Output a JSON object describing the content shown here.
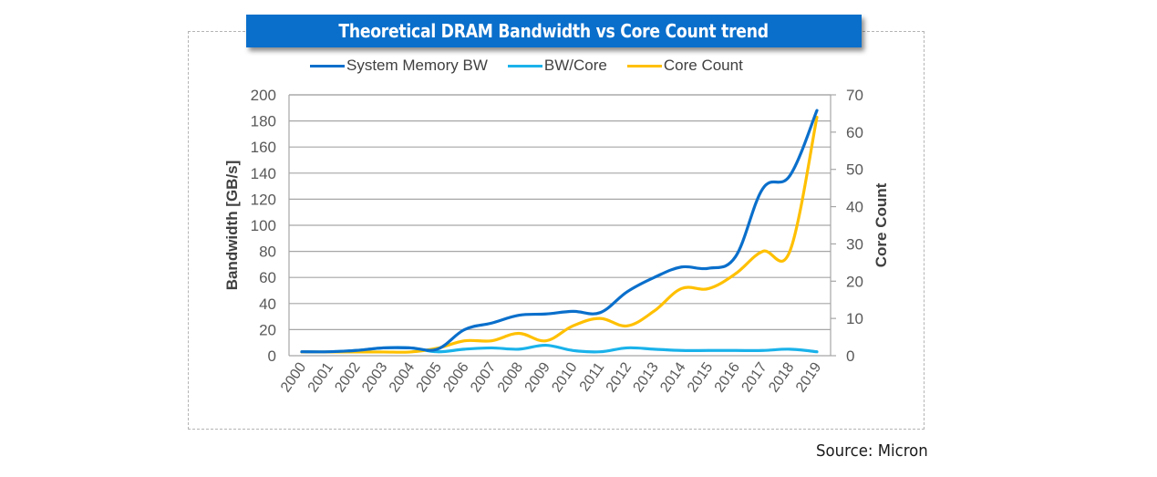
{
  "title": "Theoretical DRAM Bandwidth vs Core Count trend",
  "source": "Source: Micron",
  "chart_data": {
    "type": "line",
    "title": "Theoretical DRAM Bandwidth vs Core Count trend",
    "x": [
      "2000",
      "2001",
      "2002",
      "2003",
      "2004",
      "2005",
      "2006",
      "2007",
      "2008",
      "2009",
      "2010",
      "2011",
      "2012",
      "2013",
      "2014",
      "2015",
      "2016",
      "2017",
      "2018",
      "2019"
    ],
    "xlabel": "",
    "ylabel": "Bandwidth [GB/s]",
    "ylim": [
      0,
      200
    ],
    "yticks": [
      0,
      20,
      40,
      60,
      80,
      100,
      120,
      140,
      160,
      180,
      200
    ],
    "y2label": "Core Count",
    "y2lim": [
      0,
      70
    ],
    "y2ticks": [
      0,
      10,
      20,
      30,
      40,
      50,
      60,
      70
    ],
    "grid": true,
    "legend": "top",
    "series": [
      {
        "name": "System Memory BW",
        "axis": "left",
        "color": "#0a6fcb",
        "values": [
          3,
          3,
          4,
          6,
          6,
          5,
          20,
          25,
          31,
          32,
          34,
          33,
          49,
          60,
          68,
          67,
          76,
          128,
          138,
          188
        ]
      },
      {
        "name": "BW/Core",
        "axis": "left",
        "color": "#1ab2ea",
        "values": [
          3,
          3,
          4,
          6,
          6,
          3,
          5,
          6,
          5,
          8,
          4,
          3,
          6,
          5,
          4,
          4,
          4,
          4,
          5,
          3
        ]
      },
      {
        "name": "Core Count",
        "axis": "right",
        "color": "#ffc000",
        "values": [
          1,
          1,
          1,
          1,
          1,
          2,
          4,
          4,
          6,
          4,
          8,
          10,
          8,
          12,
          18,
          18,
          22,
          28,
          28,
          64
        ]
      }
    ]
  }
}
